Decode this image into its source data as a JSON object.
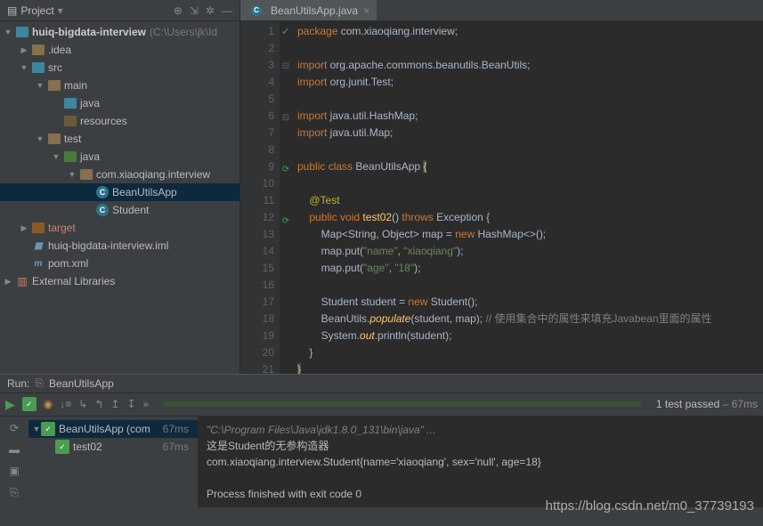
{
  "project_panel": {
    "title": "Project",
    "root_name": "huiq-bigdata-interview",
    "root_path": "(C:\\Users\\jk\\Id",
    "tree": {
      "idea": ".idea",
      "src": "src",
      "main": "main",
      "java1": "java",
      "resources": "resources",
      "test": "test",
      "java2": "java",
      "pkg": "com.xiaoqiang.interview",
      "bean": "BeanUtilsApp",
      "student": "Student",
      "target": "target",
      "iml": "huiq-bigdata-interview.iml",
      "pom": "pom.xml",
      "ext": "External Libraries"
    }
  },
  "editor": {
    "tab_name": "BeanUtilsApp.java",
    "lines": [
      {
        "n": 1,
        "html": "<span class='kw'>package</span> com.xiaoqiang.interview;"
      },
      {
        "n": 2,
        "html": ""
      },
      {
        "n": 3,
        "html": "<span class='kw'>import</span> org.apache.commons.beanutils.BeanUtils;"
      },
      {
        "n": 4,
        "html": "<span class='kw'>import</span> org.junit.Test;"
      },
      {
        "n": 5,
        "html": ""
      },
      {
        "n": 6,
        "html": "<span class='kw'>import</span> java.util.HashMap;"
      },
      {
        "n": 7,
        "html": "<span class='kw'>import</span> java.util.Map;"
      },
      {
        "n": 8,
        "html": ""
      },
      {
        "n": 9,
        "html": "<span class='kw'>public class</span> BeanUtilsApp <span class='ybr'>{</span>"
      },
      {
        "n": 10,
        "html": ""
      },
      {
        "n": 11,
        "html": "    <span class='ann'>@Test</span>"
      },
      {
        "n": 12,
        "html": "    <span class='kw'>public void</span> <span class='fn'>test02</span>() <span class='kw'>throws</span> Exception {"
      },
      {
        "n": 13,
        "html": "        Map&lt;String, Object&gt; map = <span class='kw'>new</span> HashMap&lt;&gt;();"
      },
      {
        "n": 14,
        "html": "        map.put(<span class='str'>\"name\"</span>, <span class='str'>\"xiaoqiang\"</span>);"
      },
      {
        "n": 15,
        "html": "        map.put(<span class='str'>\"age\"</span>, <span class='str'>\"18\"</span>);"
      },
      {
        "n": 16,
        "html": ""
      },
      {
        "n": 17,
        "html": "        Student student = <span class='kw'>new</span> Student();"
      },
      {
        "n": 18,
        "html": "        BeanUtils.<span class='fn'><i>populate</i></span>(student, map); <span class='com'>// 使用集合中的属性来填充Javabean里面的属性</span>"
      },
      {
        "n": 19,
        "html": "        System.<span class='fn'><i>out</i></span>.println(student);"
      },
      {
        "n": 20,
        "html": "    }"
      },
      {
        "n": 21,
        "html": "<span class='ybr'>}</span>"
      }
    ]
  },
  "run": {
    "label": "Run:",
    "config": "BeanUtilsApp",
    "status_passed": "1 test passed",
    "status_time": "– 67ms",
    "test_root": "BeanUtilsApp (com",
    "test_root_time": "67ms",
    "test_child": "test02",
    "test_child_time": "67ms",
    "console_cmd": "\"C:\\Program Files\\Java\\jdk1.8.0_131\\bin\\java\" ...",
    "console_l1": "这是Student的无参构造器",
    "console_l2": "com.xiaoqiang.interview.Student{name='xiaoqiang', sex='null', age=18}",
    "console_l3": "Process finished with exit code 0"
  },
  "watermark": "https://blog.csdn.net/m0_37739193"
}
